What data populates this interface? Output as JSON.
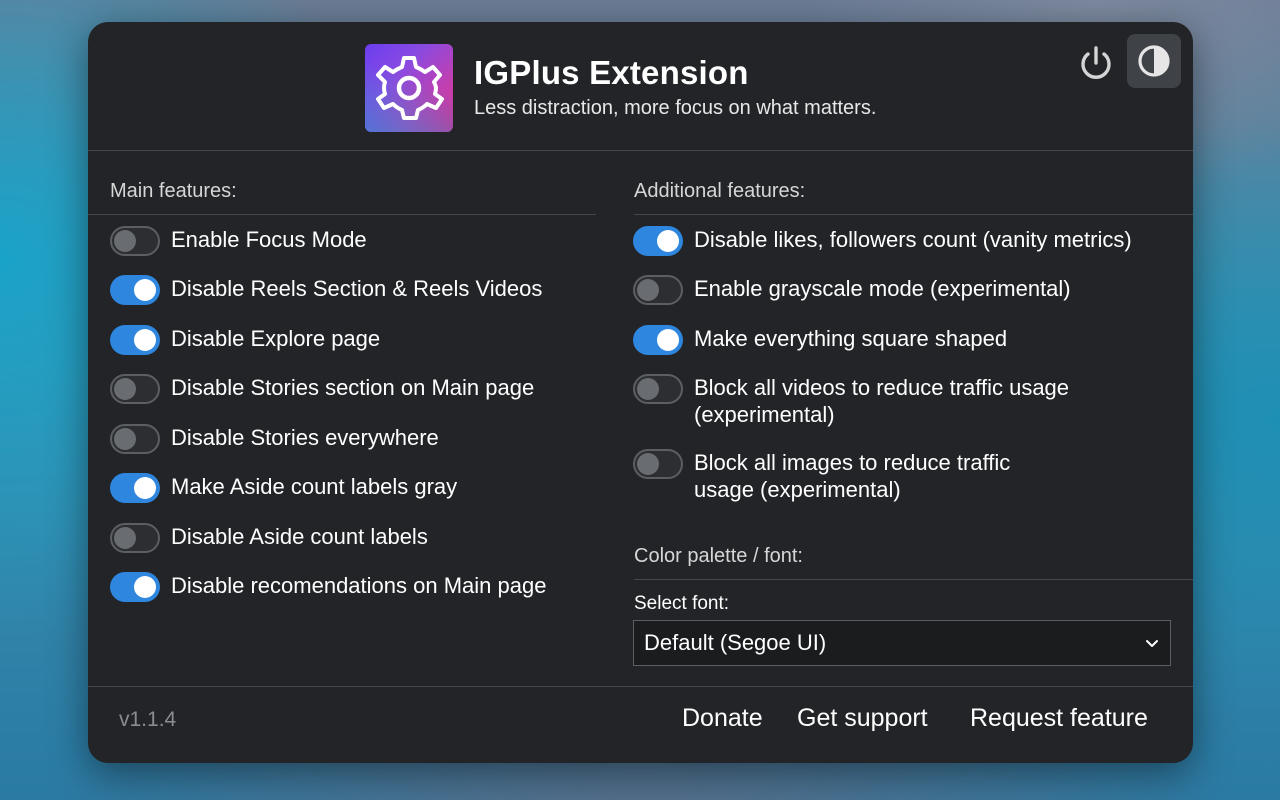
{
  "header": {
    "title": "IGPlus Extension",
    "subtitle": "Less distraction, more focus on what matters.",
    "logo_icon": "gear-icon",
    "power_icon": "power-icon",
    "theme_icon": "contrast-icon"
  },
  "main_features": {
    "title": "Main features:",
    "items": [
      {
        "label": "Enable Focus Mode",
        "enabled": false
      },
      {
        "label": "Disable Reels Section & Reels Videos",
        "enabled": true
      },
      {
        "label": "Disable Explore page",
        "enabled": true
      },
      {
        "label": "Disable Stories section on Main page",
        "enabled": false
      },
      {
        "label": "Disable Stories everywhere",
        "enabled": false
      },
      {
        "label": "Make Aside count labels gray",
        "enabled": true
      },
      {
        "label": "Disable Aside count labels",
        "enabled": false
      },
      {
        "label": "Disable recomendations on Main page",
        "enabled": true
      }
    ]
  },
  "additional_features": {
    "title": "Additional features:",
    "items": [
      {
        "label": "Disable likes, followers count (vanity metrics)",
        "enabled": true
      },
      {
        "label": "Enable grayscale mode (experimental)",
        "enabled": false
      },
      {
        "label": "Make everything square shaped",
        "enabled": true
      },
      {
        "label": "Block all videos to reduce traffic usage (experimental)",
        "enabled": false
      },
      {
        "label": "Block all images to reduce traffic usage (experimental)",
        "enabled": false
      }
    ]
  },
  "palette": {
    "title": "Color palette / font:",
    "select_label": "Select font:",
    "selected_font": "Default (Segoe UI)"
  },
  "footer": {
    "version": "v1.1.4",
    "links": [
      "Donate",
      "Get support",
      "Request feature"
    ]
  },
  "colors": {
    "accent": "#2e86de",
    "panel_bg": "#222427"
  }
}
